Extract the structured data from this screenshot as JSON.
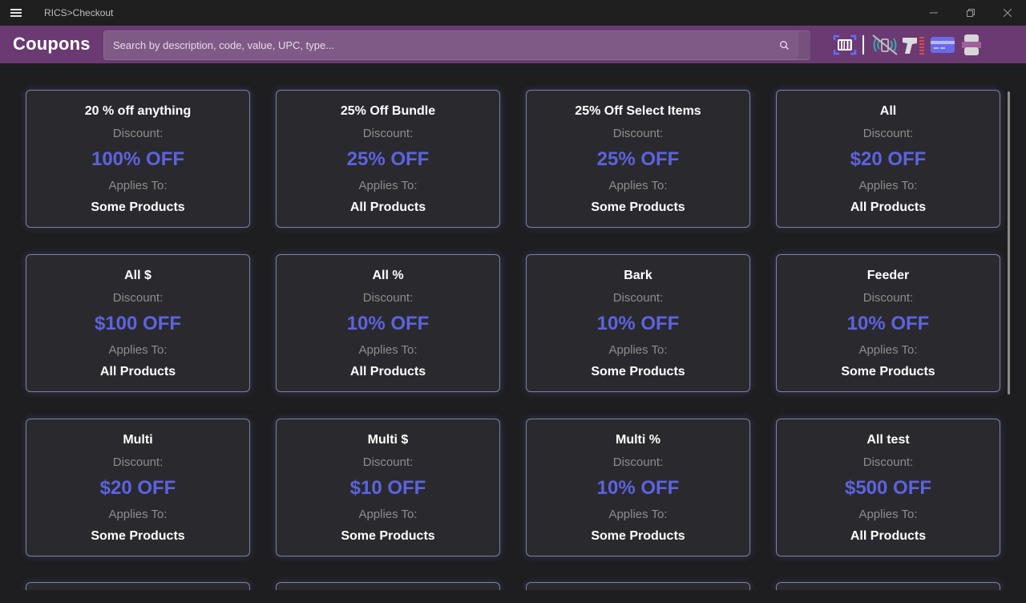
{
  "window": {
    "title": "RICS>Checkout",
    "controls": [
      "minimize",
      "restore",
      "close"
    ]
  },
  "header": {
    "title": "Coupons",
    "search_placeholder": "Search by description, code, value, UPC, type...",
    "search_value": "",
    "tools": [
      "barcode-scan-icon",
      "nfc-off-icon",
      "scanner-icon",
      "credit-card-icon",
      "printer-icon"
    ]
  },
  "labels": {
    "discount": "Discount:",
    "applies_to": "Applies To:"
  },
  "coupons": [
    {
      "name": "20 % off anything",
      "discount": "100% OFF",
      "applies": "Some Products"
    },
    {
      "name": "25% Off Bundle",
      "discount": "25% OFF",
      "applies": "All Products"
    },
    {
      "name": "25% Off Select Items",
      "discount": "25% OFF",
      "applies": "Some Products"
    },
    {
      "name": "All",
      "discount": "$20 OFF",
      "applies": "All Products"
    },
    {
      "name": "All $",
      "discount": "$100 OFF",
      "applies": "All Products"
    },
    {
      "name": "All %",
      "discount": "10% OFF",
      "applies": "All Products"
    },
    {
      "name": "Bark",
      "discount": "10% OFF",
      "applies": "Some Products"
    },
    {
      "name": "Feeder",
      "discount": "10% OFF",
      "applies": "Some Products"
    },
    {
      "name": "Multi",
      "discount": "$20 OFF",
      "applies": "Some Products"
    },
    {
      "name": "Multi $",
      "discount": "$10 OFF",
      "applies": "Some Products"
    },
    {
      "name": "Multi %",
      "discount": "10% OFF",
      "applies": "Some Products"
    },
    {
      "name": "All test",
      "discount": "$500 OFF",
      "applies": "All Products"
    }
  ],
  "colors": {
    "accent": "#6b3a73",
    "discount_value": "#5c63e0",
    "card_bg": "#2a2a2e",
    "page_bg": "#1e1e20"
  }
}
